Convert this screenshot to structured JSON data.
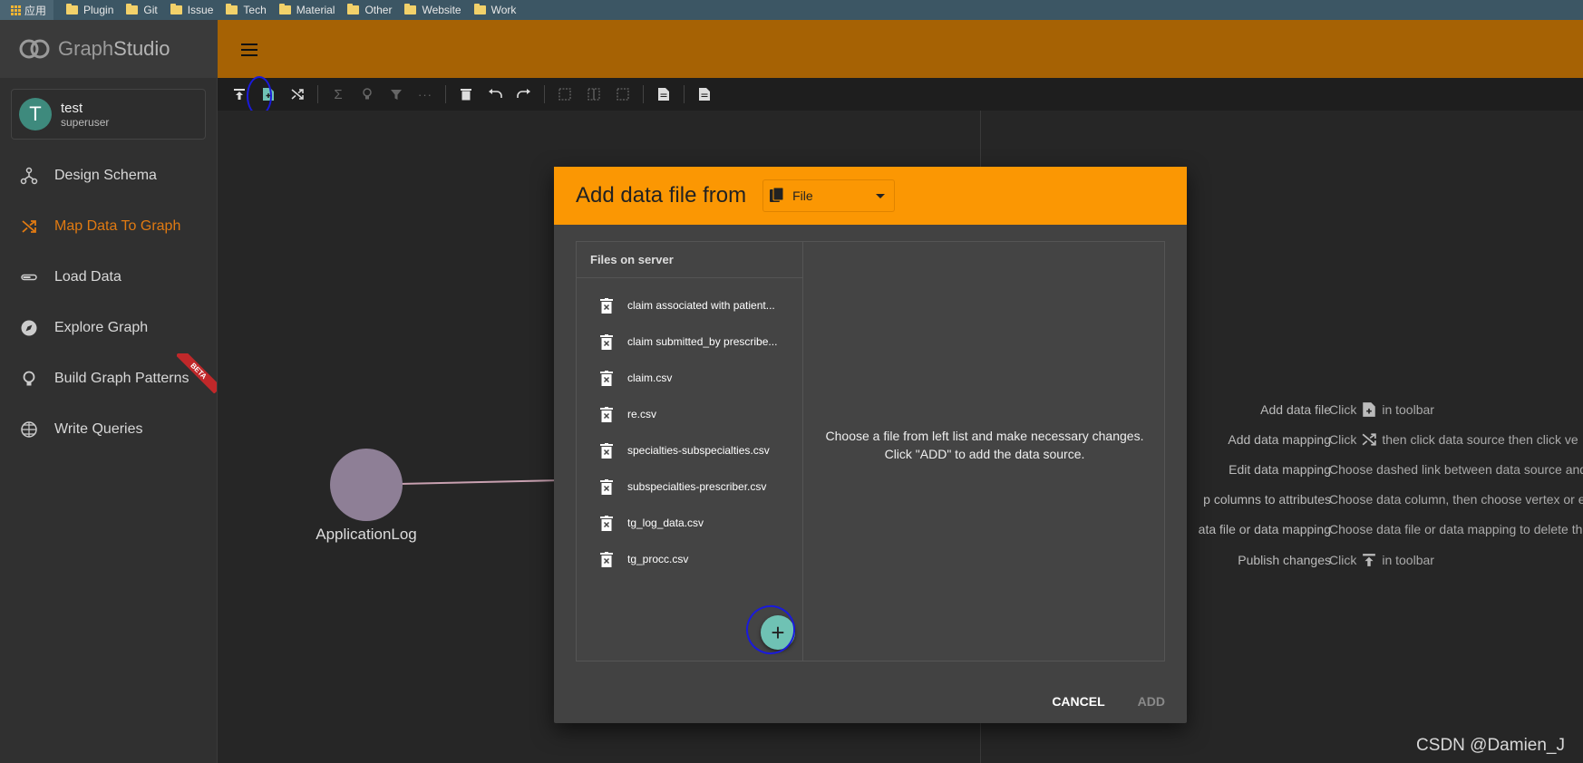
{
  "bookmarks": {
    "apps_label": "应用",
    "items": [
      "Plugin",
      "Git",
      "Issue",
      "Tech",
      "Material",
      "Other",
      "Website",
      "Work"
    ]
  },
  "app": {
    "logo_left": "Graph",
    "logo_right": "Studio"
  },
  "user": {
    "initial": "T",
    "name": "test",
    "role": "superuser"
  },
  "nav": [
    {
      "label": "Design Schema",
      "icon": "schema-icon"
    },
    {
      "label": "Map Data To Graph",
      "icon": "shuffle-icon",
      "active": true
    },
    {
      "label": "Load Data",
      "icon": "load-icon"
    },
    {
      "label": "Explore Graph",
      "icon": "compass-icon"
    },
    {
      "label": "Build Graph Patterns",
      "icon": "bulb-icon",
      "badge": "BETA"
    },
    {
      "label": "Write Queries",
      "icon": "globe-icon"
    }
  ],
  "graph": {
    "node_label": "ApplicationLog"
  },
  "help": [
    {
      "label": "Add data file",
      "prefix": "Click",
      "suffix": "in toolbar"
    },
    {
      "label": "Add data mapping",
      "prefix": "Click",
      "suffix": "then click data source then click ve"
    },
    {
      "label": "Edit data mapping",
      "prefix": "",
      "suffix": "Choose dashed link between data source and"
    },
    {
      "label": "p columns to attributes",
      "prefix": "",
      "suffix": "Choose data column, then choose vertex or e"
    },
    {
      "label": "ata file or data mapping",
      "prefix": "",
      "suffix": "Choose data file or data mapping to delete th"
    },
    {
      "label": "Publish changes",
      "prefix": "Click",
      "suffix": "in toolbar"
    }
  ],
  "dialog": {
    "title": "Add data file from",
    "source_value": "File",
    "files_header": "Files on server",
    "files": [
      "claim associated with patient...",
      "claim submitted_by prescribe...",
      "claim.csv",
      "re.csv",
      "specialties-subspecialties.csv",
      "subspecialties-prescriber.csv",
      "tg_log_data.csv",
      "tg_procc.csv"
    ],
    "add_fab": "+",
    "detail_line1": "Choose a file from left list and make necessary changes.",
    "detail_line2": "Click \"ADD\" to add the data source.",
    "cancel_label": "CANCEL",
    "add_label": "ADD"
  },
  "watermark": "CSDN @Damien_J",
  "colors": {
    "accent": "#fb9703",
    "header": "#a66204",
    "active_nav": "#e07a12",
    "fab": "#6fc2b4"
  }
}
